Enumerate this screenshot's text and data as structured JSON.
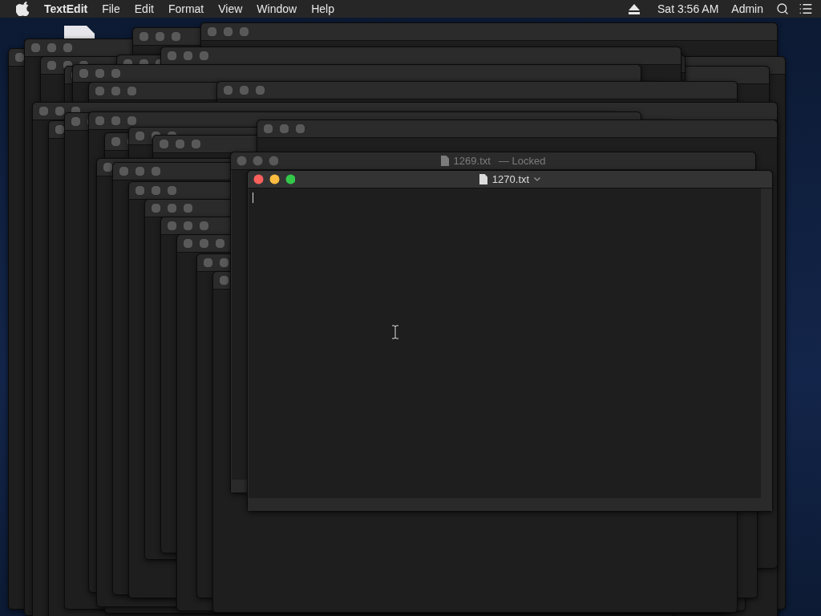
{
  "menu_bar": {
    "app_name": "TextEdit",
    "menus": [
      "File",
      "Edit",
      "Format",
      "View",
      "Window",
      "Help"
    ],
    "clock": "Sat 3:56 AM",
    "user": "Admin"
  },
  "windows": [
    {
      "title": "1269.txt",
      "status": "— Locked",
      "active": false
    },
    {
      "title": "1270.txt",
      "active": true
    }
  ]
}
